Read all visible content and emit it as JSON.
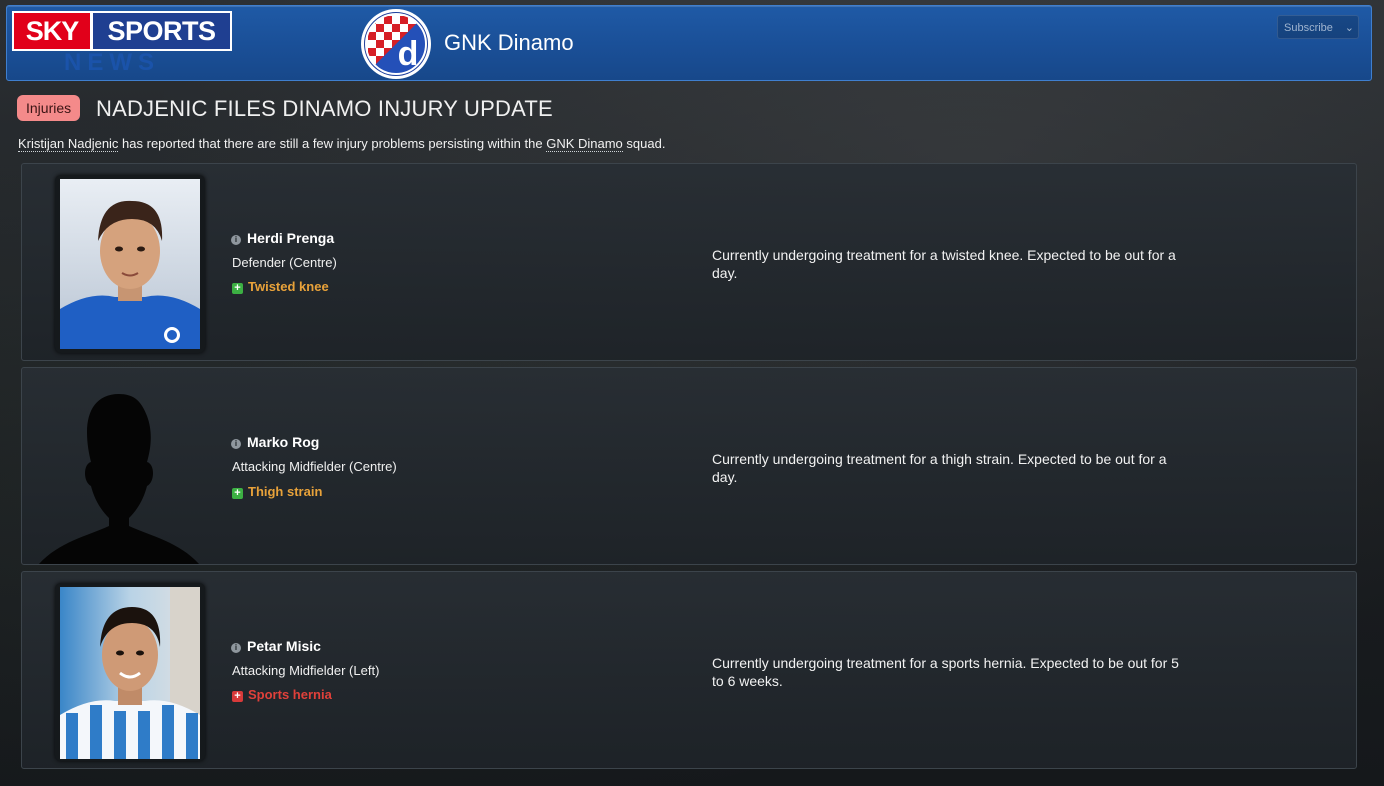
{
  "header": {
    "logo": {
      "sky": "SKY",
      "sports": "SPORTS",
      "news": "NEWS"
    },
    "club_name": "GNK Dinamo",
    "badge_letter": "d",
    "subscribe_label": "Subscribe"
  },
  "article": {
    "tag": "Injuries",
    "headline": "NADJENIC FILES DINAMO INJURY UPDATE",
    "intro": {
      "person": "Kristijan Nadjenic",
      "text_before_club": " has reported that there are still a few injury problems persisting within the ",
      "club": "GNK Dinamo",
      "text_end": " squad."
    }
  },
  "players": [
    {
      "name": "Herdi Prenga",
      "position": "Defender (Centre)",
      "injury": "Twisted knee",
      "injury_color": "#e8a23a",
      "icon_color": "#3cb043",
      "description": "Currently undergoing treatment for a twisted knee. Expected to be out for a day."
    },
    {
      "name": "Marko Rog",
      "position": "Attacking Midfielder (Centre)",
      "injury": "Thigh strain",
      "injury_color": "#e8a23a",
      "icon_color": "#3cb043",
      "description": "Currently undergoing treatment for a thigh strain. Expected to be out for a day."
    },
    {
      "name": "Petar Misic",
      "position": "Attacking Midfielder (Left)",
      "injury": "Sports hernia",
      "injury_color": "#e0403a",
      "icon_color": "#d83a3a",
      "description": "Currently undergoing treatment for a sports hernia. Expected to be out for 5 to 6 weeks."
    }
  ]
}
